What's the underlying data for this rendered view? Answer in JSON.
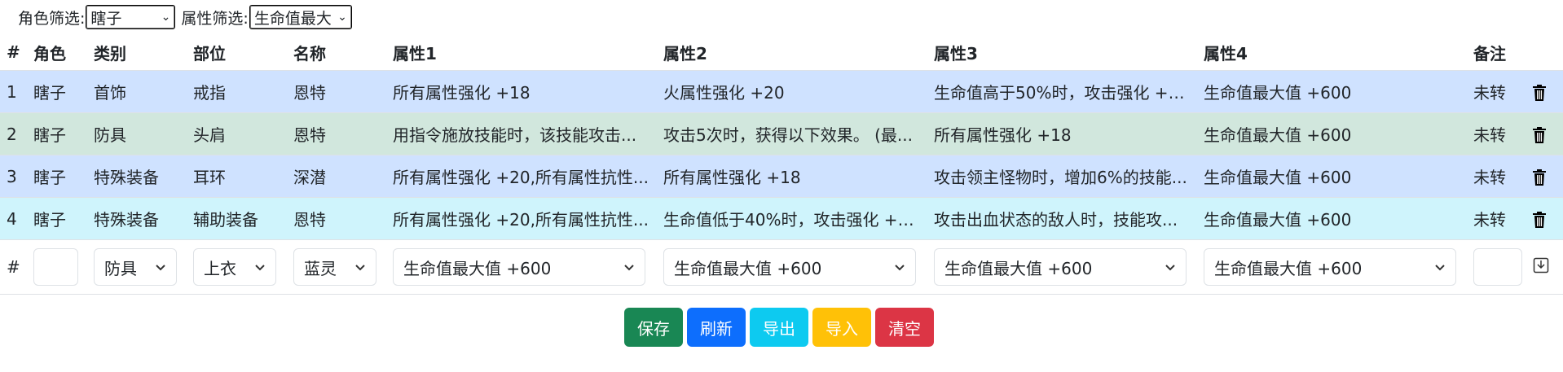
{
  "filters": {
    "role_label": "角色筛选:",
    "role_value": "瞎子",
    "attr_label": "属性筛选:",
    "attr_value": "生命值最大"
  },
  "table": {
    "headers": [
      "#",
      "角色",
      "类别",
      "部位",
      "名称",
      "属性1",
      "属性2",
      "属性3",
      "属性4",
      "备注"
    ],
    "rows": [
      {
        "num": "1",
        "role": "瞎子",
        "category": "首饰",
        "slot": "戒指",
        "name": "恩特",
        "attr1": "所有属性强化 +18",
        "attr2": "火属性强化 +20",
        "attr3": "生命值高于50%时，攻击强化 +2...",
        "attr4": "生命值最大值 +600",
        "note": "未转",
        "color": "#cfe2ff"
      },
      {
        "num": "2",
        "role": "瞎子",
        "category": "防具",
        "slot": "头肩",
        "name": "恩特",
        "attr1": "用指令施放技能时，该技能攻击...",
        "attr2": "攻击5次时，获得以下效果。 (最...",
        "attr3": "所有属性强化 +18",
        "attr4": "生命值最大值 +600",
        "note": "未转",
        "color": "#d1e7dd"
      },
      {
        "num": "3",
        "role": "瞎子",
        "category": "特殊装备",
        "slot": "耳环",
        "name": "深潜",
        "attr1": "所有属性强化 +20,所有属性抗性...",
        "attr2": "所有属性强化 +18",
        "attr3": "攻击领主怪物时，增加6%的技能...",
        "attr4": "生命值最大值 +600",
        "note": "未转",
        "color": "#cfe2ff"
      },
      {
        "num": "4",
        "role": "瞎子",
        "category": "特殊装备",
        "slot": "辅助装备",
        "name": "恩特",
        "attr1": "所有属性强化 +20,所有属性抗性...",
        "attr2": "生命值低于40%时，攻击强化 +3...",
        "attr3": "攻击出血状态的敌人时，技能攻...",
        "attr4": "生命值最大值 +600",
        "note": "未转",
        "color": "#cff4fc"
      }
    ]
  },
  "input_row": {
    "num": "#",
    "category": "防具",
    "slot": "上衣",
    "name": "蓝灵",
    "attr1": "生命值最大值 +600",
    "attr2": "生命值最大值 +600",
    "attr3": "生命值最大值 +600",
    "attr4": "生命值最大值 +600"
  },
  "buttons": [
    {
      "label": "保存",
      "color": "#198754"
    },
    {
      "label": "刷新",
      "color": "#0d6efd"
    },
    {
      "label": "导出",
      "color": "#0dcaf0"
    },
    {
      "label": "导入",
      "color": "#ffc107"
    },
    {
      "label": "清空",
      "color": "#dc3545"
    }
  ]
}
